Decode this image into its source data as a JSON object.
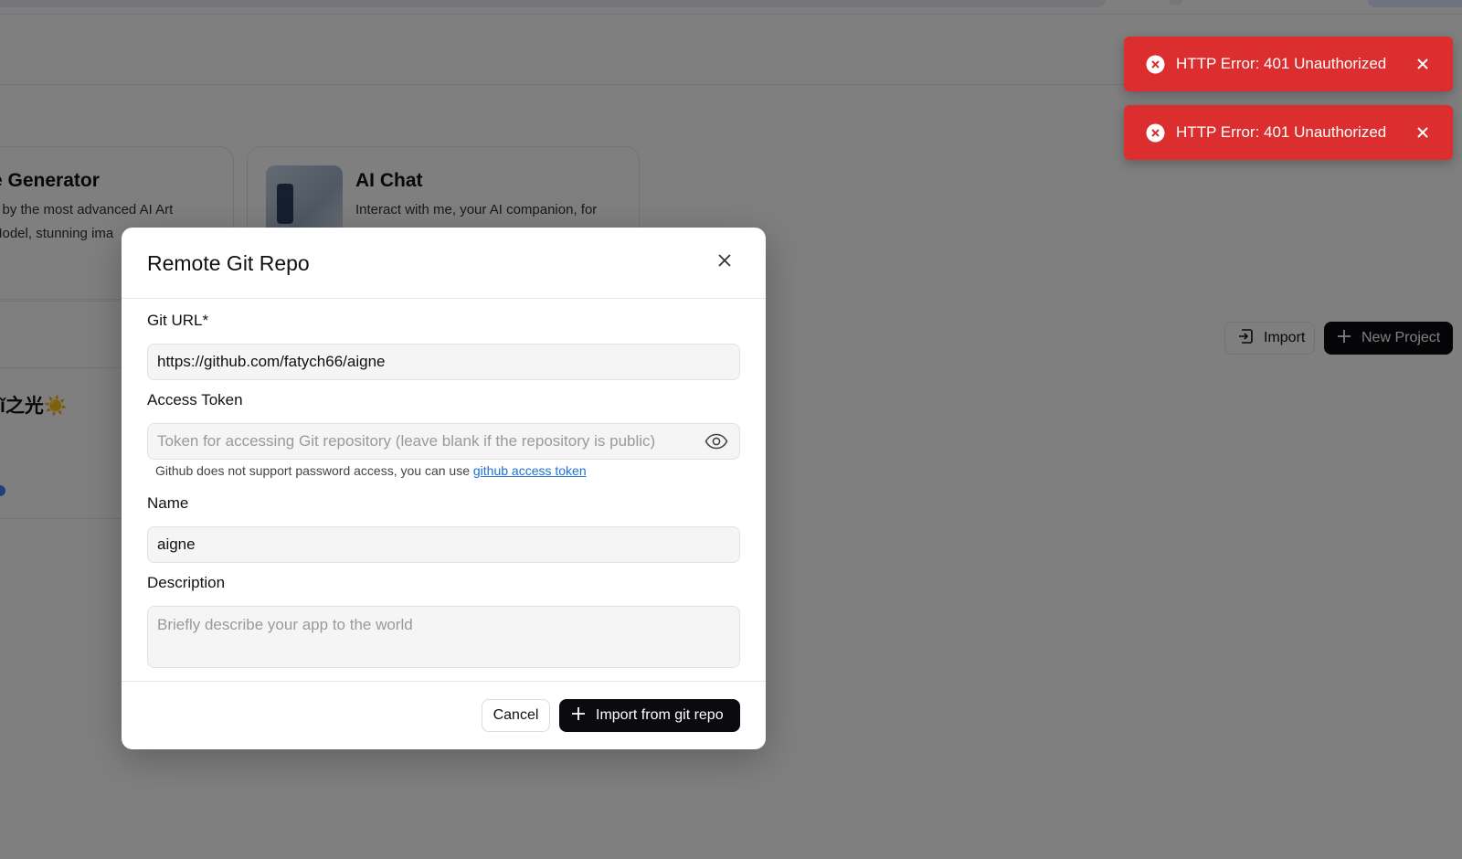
{
  "background": {
    "cards": [
      {
        "title": "e Generator",
        "desc_line1": "d by the most advanced AI Art",
        "desc_line2": "Model, stunning ima"
      },
      {
        "title": "AI Chat",
        "desc_line1": "Interact with me, your AI companion, for"
      }
    ],
    "list_item_title": "ǐ之光☀️",
    "import_label": "Import",
    "new_project_label": "New Project"
  },
  "dialog": {
    "title": "Remote Git Repo",
    "git_url": {
      "label": "Git URL*",
      "value": "https://github.com/fatych66/aigne"
    },
    "access_token": {
      "label": "Access Token",
      "placeholder": "Token for accessing Git repository (leave blank if the repository is public)",
      "helper_text": "Github does not support password access, you can use ",
      "helper_link": "github access token"
    },
    "name": {
      "label": "Name",
      "value": "aigne"
    },
    "description": {
      "label": "Description",
      "placeholder": "Briefly describe your app to the world"
    },
    "cancel_label": "Cancel",
    "submit_label": "Import from git repo"
  },
  "toasts": [
    {
      "message": "HTTP Error: 401 Unauthorized"
    },
    {
      "message": "HTTP Error: 401 Unauthorized"
    }
  ],
  "icons": {
    "toast_error": "error-circle-icon",
    "close": "close-icon",
    "eye": "eye-icon",
    "plus": "plus-icon",
    "import": "import-icon"
  },
  "colors": {
    "toast_bg": "#dc2e2e",
    "primary_button": "#0b0b0f",
    "link": "#1d6fd1"
  }
}
